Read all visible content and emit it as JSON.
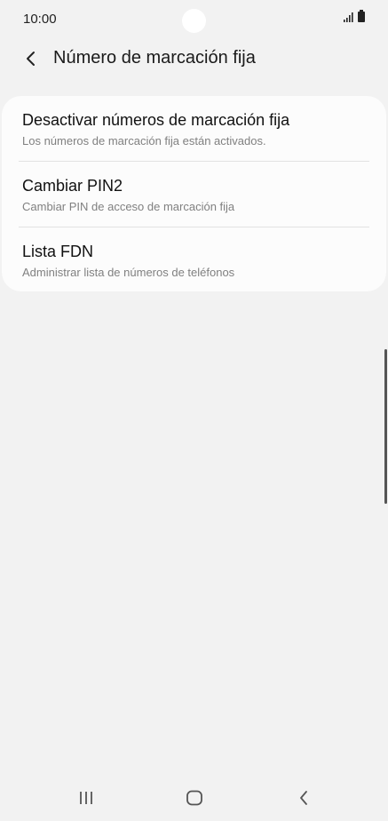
{
  "status_bar": {
    "time": "10:00",
    "icons": [
      "signal-icon",
      "battery-icon"
    ]
  },
  "app_bar": {
    "back_icon": "chevron-left-icon",
    "title": "Número de marcación fija"
  },
  "settings": {
    "items": [
      {
        "title": "Desactivar números de marcación fija",
        "subtitle": "Los números de marcación fija están activados."
      },
      {
        "title": "Cambiar PIN2",
        "subtitle": "Cambiar PIN de acceso de marcación fija"
      },
      {
        "title": "Lista FDN",
        "subtitle": "Administrar lista de números de teléfonos"
      }
    ]
  },
  "nav_bar": {
    "icons": [
      "recent-apps-icon",
      "home-icon",
      "back-icon"
    ]
  },
  "colors": {
    "background": "#f2f2f2",
    "card": "#fcfcfc",
    "subtitle": "#808080"
  }
}
